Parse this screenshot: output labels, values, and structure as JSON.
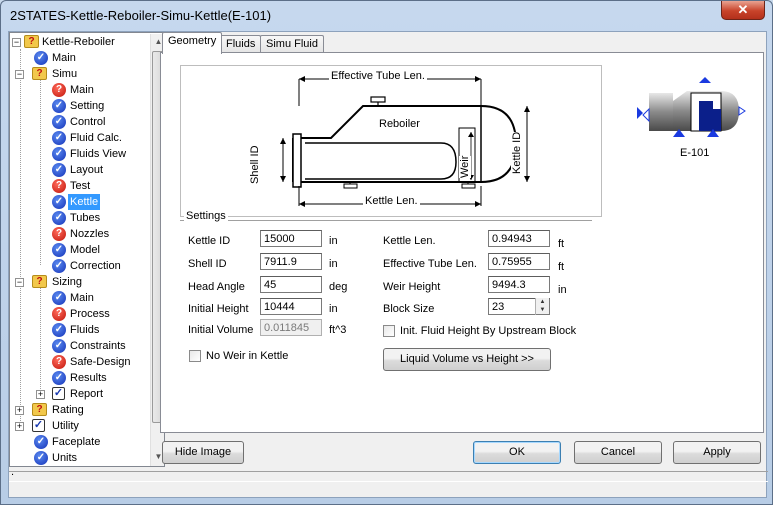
{
  "window": {
    "title": "2STATES-Kettle-Reboiler-Simu-Kettle(E-101)",
    "close_label": "✕"
  },
  "tree": {
    "root": "Kettle-Reboiler",
    "items": [
      {
        "label": "Main"
      },
      {
        "label": "Simu"
      },
      {
        "label": "Main"
      },
      {
        "label": "Setting"
      },
      {
        "label": "Control"
      },
      {
        "label": "Fluid Calc."
      },
      {
        "label": "Fluids View"
      },
      {
        "label": "Layout"
      },
      {
        "label": "Test"
      },
      {
        "label": "Kettle"
      },
      {
        "label": "Tubes"
      },
      {
        "label": "Nozzles"
      },
      {
        "label": "Model"
      },
      {
        "label": "Correction"
      },
      {
        "label": "Sizing"
      },
      {
        "label": "Main"
      },
      {
        "label": "Process"
      },
      {
        "label": "Fluids"
      },
      {
        "label": "Constraints"
      },
      {
        "label": "Safe-Design"
      },
      {
        "label": "Results"
      },
      {
        "label": "Report"
      },
      {
        "label": "Rating"
      },
      {
        "label": "Utility"
      },
      {
        "label": "Faceplate"
      },
      {
        "label": "Units"
      }
    ]
  },
  "tabs": [
    {
      "label": "Geometry"
    },
    {
      "label": "Fluids"
    },
    {
      "label": "Simu Fluid"
    }
  ],
  "diagram": {
    "effective_tube_len": "Effective Tube Len.",
    "reboiler": "Reboiler",
    "shell_id": "Shell ID",
    "weir": "Weir",
    "kettle_id": "Kettle ID",
    "kettle_len": "Kettle Len."
  },
  "settings": {
    "legend": "Settings",
    "kettle_id": {
      "label": "Kettle ID",
      "value": "15000",
      "unit": "in"
    },
    "shell_id": {
      "label": "Shell ID",
      "value": "7911.9",
      "unit": "in"
    },
    "head_angle": {
      "label": "Head Angle",
      "value": "45",
      "unit": "deg"
    },
    "initial_height": {
      "label": "Initial Height",
      "value": "10444",
      "unit": "in"
    },
    "initial_volume": {
      "label": "Initial Volume",
      "value": "0.011845",
      "unit": "ft^3"
    },
    "kettle_len": {
      "label": "Kettle Len.",
      "value": "0.94943",
      "unit": "ft"
    },
    "effective_tube_len": {
      "label": "Effective Tube Len.",
      "value": "0.75955",
      "unit": "ft"
    },
    "weir_height": {
      "label": "Weir Height",
      "value": "9494.3",
      "unit": "in"
    },
    "block_size": {
      "label": "Block Size",
      "value": "23"
    },
    "init_fluid_height": {
      "label": "Init. Fluid Height By Upstream Block"
    },
    "no_weir": {
      "label": "No Weir in Kettle"
    },
    "liquid_volume_btn": "Liquid Volume vs Height >>"
  },
  "thumbnail": {
    "label": "E-101"
  },
  "buttons": {
    "hide_image": "Hide Image",
    "ok": "OK",
    "cancel": "Cancel",
    "apply": "Apply"
  },
  "status": {
    "text": "."
  }
}
